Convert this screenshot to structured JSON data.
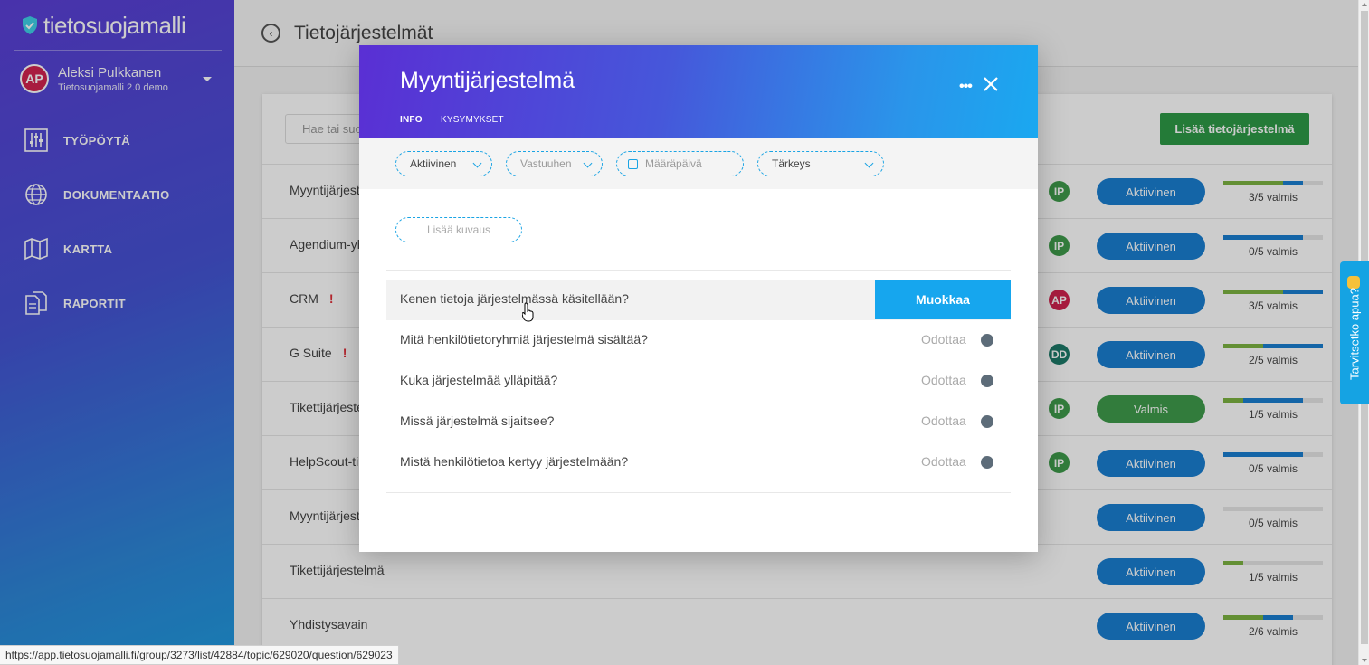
{
  "sidebar": {
    "logo_text": "tietosuojamalli",
    "user": {
      "initials": "AP",
      "name": "Aleksi Pulkkanen",
      "org": "Tietosuojamalli 2.0 demo"
    },
    "nav": [
      {
        "label": "TYÖPÖYTÄ",
        "icon": "sliders-icon"
      },
      {
        "label": "DOKUMENTAATIO",
        "icon": "globe-icon"
      },
      {
        "label": "KARTTA",
        "icon": "map-icon"
      },
      {
        "label": "RAPORTIT",
        "icon": "reports-icon"
      }
    ]
  },
  "page": {
    "title": "Tietojärjestelmät",
    "search_placeholder": "Hae tai suodata",
    "add_button": "Lisää tietojärjestelmä",
    "rows": [
      {
        "name": "Myyntijärjestelmä",
        "warn": "",
        "avatar": "IP",
        "avatar_color": "#3f9c4c",
        "status": "Aktiivinen",
        "status_color": "#1a7fd1",
        "progress_green": 0.6,
        "progress_blue": 0.8,
        "progress_label": "3/5 valmis"
      },
      {
        "name": "Agendium-yhteystiedot",
        "warn": "",
        "avatar": "IP",
        "avatar_color": "#3f9c4c",
        "status": "Aktiivinen",
        "status_color": "#1a7fd1",
        "progress_green": 0.0,
        "progress_blue": 0.8,
        "progress_label": "0/5 valmis"
      },
      {
        "name": "CRM",
        "warn": "!",
        "avatar": "AP",
        "avatar_color": "#d2244f",
        "status": "Aktiivinen",
        "status_color": "#1a7fd1",
        "progress_green": 0.6,
        "progress_blue": 1.0,
        "progress_label": "3/5 valmis"
      },
      {
        "name": "G Suite",
        "warn": "!",
        "avatar": "DD",
        "avatar_color": "#1d7b6a",
        "status": "Aktiivinen",
        "status_color": "#1a7fd1",
        "progress_green": 0.4,
        "progress_blue": 1.0,
        "progress_label": "2/5 valmis"
      },
      {
        "name": "Tikettijärjestelmä",
        "warn": "",
        "avatar": "IP",
        "avatar_color": "#3f9c4c",
        "status": "Valmis",
        "status_color": "#3f9c4c",
        "progress_green": 0.2,
        "progress_blue": 0.8,
        "progress_label": "1/5 valmis"
      },
      {
        "name": "HelpScout-tiketit",
        "warn": "",
        "avatar": "IP",
        "avatar_color": "#3f9c4c",
        "status": "Aktiivinen",
        "status_color": "#1a7fd1",
        "progress_green": 0.0,
        "progress_blue": 0.8,
        "progress_label": "0/5 valmis"
      },
      {
        "name": "Myyntijärjestelmä",
        "warn": "",
        "avatar": "",
        "avatar_color": "",
        "status": "Aktiivinen",
        "status_color": "#1a7fd1",
        "progress_green": 0.0,
        "progress_blue": 0.0,
        "progress_label": "0/5 valmis"
      },
      {
        "name": "Tikettijärjestelmä",
        "warn": "",
        "avatar": "",
        "avatar_color": "",
        "status": "Aktiivinen",
        "status_color": "#1a7fd1",
        "progress_green": 0.2,
        "progress_blue": 0.2,
        "progress_label": "1/5 valmis"
      },
      {
        "name": "Yhdistysavain",
        "warn": "",
        "avatar": "",
        "avatar_color": "",
        "status": "Aktiivinen",
        "status_color": "#1a7fd1",
        "progress_green": 0.4,
        "progress_blue": 0.7,
        "progress_label": "2/6 valmis"
      }
    ]
  },
  "modal": {
    "title": "Myyntijärjestelmä",
    "more_label": "•••",
    "tabs": [
      "INFO",
      "KYSYMYKSET"
    ],
    "filters": {
      "status": "Aktiivinen",
      "owner_placeholder": "Vastuuhen",
      "date_placeholder": "Määräpäivä",
      "priority": "Tärkeys"
    },
    "add_description": "Lisää kuvaus",
    "edit_button": "Muokkaa",
    "questions": [
      {
        "text": "Kenen tietoja järjestelmässä käsitellään?",
        "status": ""
      },
      {
        "text": "Mitä henkilötietoryhmiä järjestelmä sisältää?",
        "status": "Odottaa"
      },
      {
        "text": "Kuka järjestelmää ylläpitää?",
        "status": "Odottaa"
      },
      {
        "text": "Missä järjestelmä sijaitsee?",
        "status": "Odottaa"
      },
      {
        "text": "Mistä henkilötietoa kertyy järjestelmään?",
        "status": "Odottaa"
      }
    ]
  },
  "help_tab": "Tarvitsetko apua?",
  "status_url": "https://app.tietosuojamalli.fi/group/3273/list/42884/topic/629020/question/629023",
  "colors": {
    "accent": "#16a6ee",
    "green": "#3f9c4c",
    "blue": "#1a7fd1",
    "progress_green": "#7cb342",
    "progress_blue": "#1a7fd1"
  }
}
